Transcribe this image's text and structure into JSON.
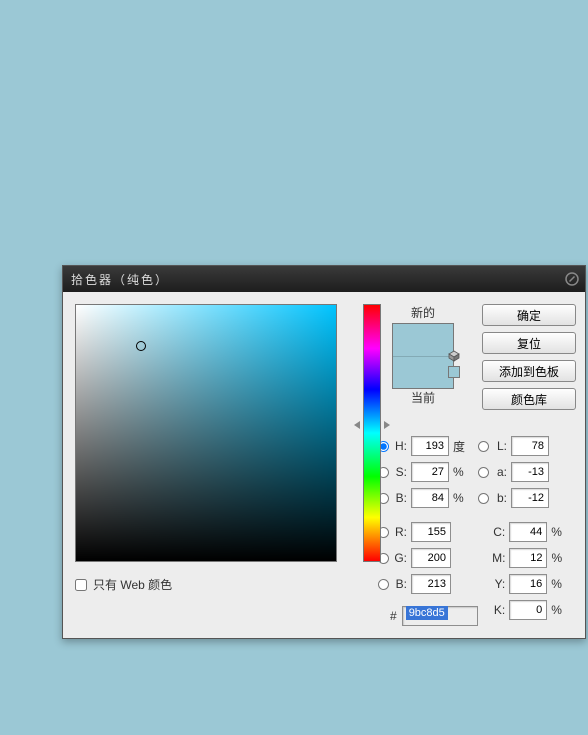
{
  "dialog": {
    "title": "拾色器（纯色）"
  },
  "swatch": {
    "new_label": "新的",
    "current_label": "当前"
  },
  "buttons": {
    "ok": "确定",
    "reset": "复位",
    "add_swatch": "添加到色板",
    "libraries": "颜色库"
  },
  "labels": {
    "H": "H:",
    "S": "S:",
    "Bv": "B:",
    "R": "R:",
    "G": "G:",
    "Bb": "B:",
    "L": "L:",
    "a": "a:",
    "b": "b:",
    "C": "C:",
    "M": "M:",
    "Y": "Y:",
    "K": "K:",
    "deg": "度",
    "pct": "%",
    "hash": "#"
  },
  "values": {
    "H": "193",
    "S": "27",
    "Bv": "84",
    "R": "155",
    "G": "200",
    "Bb": "213",
    "L": "78",
    "a": "-13",
    "b": "-12",
    "C": "44",
    "M": "12",
    "Y": "16",
    "K": "0",
    "hex": "9bc8d5"
  },
  "web_only": "只有 Web 颜色",
  "colors": {
    "picked": "#9bc8d5"
  }
}
